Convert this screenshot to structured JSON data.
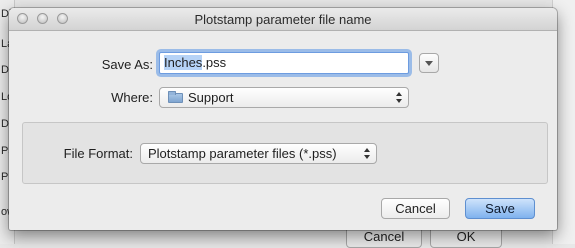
{
  "background": {
    "left_labels": [
      "Di",
      "La",
      "Da",
      "Lo",
      "De",
      "Pa",
      "Pl",
      "ow"
    ],
    "bottom_buttons": [
      "Cancel",
      "OK"
    ]
  },
  "dialog": {
    "title": "Plotstamp parameter file name",
    "save_as_label": "Save As:",
    "filename_selected": "Inches",
    "filename_rest": ".pss",
    "where_label": "Where:",
    "where_value": "Support",
    "file_format_label": "File Format:",
    "file_format_value": "Plotstamp parameter files (*.pss)",
    "cancel_label": "Cancel",
    "save_label": "Save"
  },
  "icons": {
    "expand": "chevron-down-icon",
    "folder": "folder-icon",
    "updown": "updown-arrows-icon"
  },
  "colors": {
    "focus_ring": "#6d9ce0",
    "selection": "#b6d3f7",
    "default_button": "#7fb2ee"
  }
}
